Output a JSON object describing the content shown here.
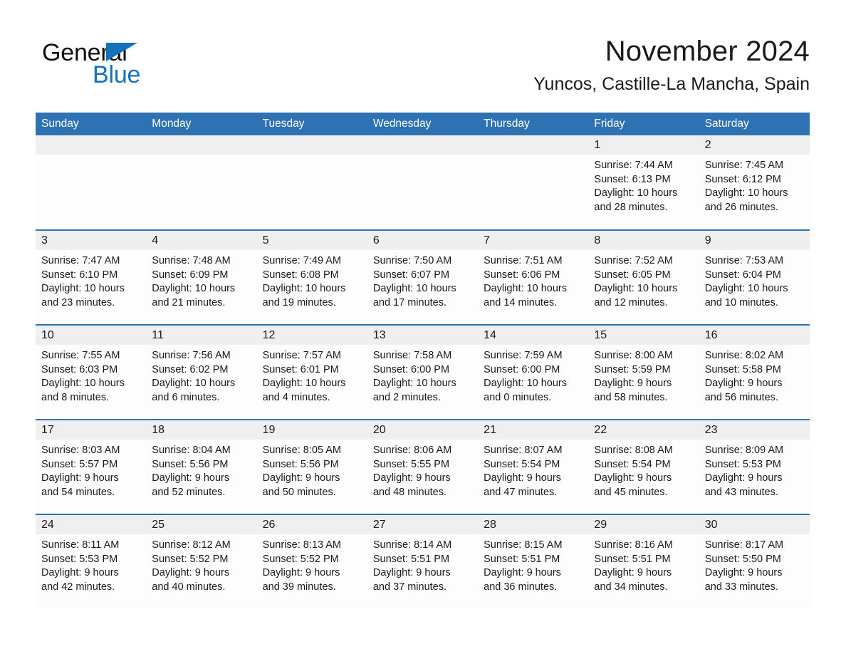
{
  "brand": {
    "logo_text_primary": "General",
    "logo_text_secondary": "Blue",
    "primary_color": "#2e72b4",
    "logo_blue": "#1571ba",
    "header_band_color": "#2e72b4",
    "daynum_band_color": "#efefef"
  },
  "header": {
    "title": "November 2024",
    "subtitle": "Yuncos, Castille-La Mancha, Spain"
  },
  "calendar": {
    "weekday_headers": [
      "Sunday",
      "Monday",
      "Tuesday",
      "Wednesday",
      "Thursday",
      "Friday",
      "Saturday"
    ],
    "weeks": [
      [
        {
          "day": "",
          "empty": true,
          "sunrise": "",
          "sunset": "",
          "daylight1": "",
          "daylight2": ""
        },
        {
          "day": "",
          "empty": true,
          "sunrise": "",
          "sunset": "",
          "daylight1": "",
          "daylight2": ""
        },
        {
          "day": "",
          "empty": true,
          "sunrise": "",
          "sunset": "",
          "daylight1": "",
          "daylight2": ""
        },
        {
          "day": "",
          "empty": true,
          "sunrise": "",
          "sunset": "",
          "daylight1": "",
          "daylight2": ""
        },
        {
          "day": "",
          "empty": true,
          "sunrise": "",
          "sunset": "",
          "daylight1": "",
          "daylight2": ""
        },
        {
          "day": "1",
          "empty": false,
          "sunrise": "Sunrise: 7:44 AM",
          "sunset": "Sunset: 6:13 PM",
          "daylight1": "Daylight: 10 hours",
          "daylight2": "and 28 minutes."
        },
        {
          "day": "2",
          "empty": false,
          "sunrise": "Sunrise: 7:45 AM",
          "sunset": "Sunset: 6:12 PM",
          "daylight1": "Daylight: 10 hours",
          "daylight2": "and 26 minutes."
        }
      ],
      [
        {
          "day": "3",
          "empty": false,
          "sunrise": "Sunrise: 7:47 AM",
          "sunset": "Sunset: 6:10 PM",
          "daylight1": "Daylight: 10 hours",
          "daylight2": "and 23 minutes."
        },
        {
          "day": "4",
          "empty": false,
          "sunrise": "Sunrise: 7:48 AM",
          "sunset": "Sunset: 6:09 PM",
          "daylight1": "Daylight: 10 hours",
          "daylight2": "and 21 minutes."
        },
        {
          "day": "5",
          "empty": false,
          "sunrise": "Sunrise: 7:49 AM",
          "sunset": "Sunset: 6:08 PM",
          "daylight1": "Daylight: 10 hours",
          "daylight2": "and 19 minutes."
        },
        {
          "day": "6",
          "empty": false,
          "sunrise": "Sunrise: 7:50 AM",
          "sunset": "Sunset: 6:07 PM",
          "daylight1": "Daylight: 10 hours",
          "daylight2": "and 17 minutes."
        },
        {
          "day": "7",
          "empty": false,
          "sunrise": "Sunrise: 7:51 AM",
          "sunset": "Sunset: 6:06 PM",
          "daylight1": "Daylight: 10 hours",
          "daylight2": "and 14 minutes."
        },
        {
          "day": "8",
          "empty": false,
          "sunrise": "Sunrise: 7:52 AM",
          "sunset": "Sunset: 6:05 PM",
          "daylight1": "Daylight: 10 hours",
          "daylight2": "and 12 minutes."
        },
        {
          "day": "9",
          "empty": false,
          "sunrise": "Sunrise: 7:53 AM",
          "sunset": "Sunset: 6:04 PM",
          "daylight1": "Daylight: 10 hours",
          "daylight2": "and 10 minutes."
        }
      ],
      [
        {
          "day": "10",
          "empty": false,
          "sunrise": "Sunrise: 7:55 AM",
          "sunset": "Sunset: 6:03 PM",
          "daylight1": "Daylight: 10 hours",
          "daylight2": "and 8 minutes."
        },
        {
          "day": "11",
          "empty": false,
          "sunrise": "Sunrise: 7:56 AM",
          "sunset": "Sunset: 6:02 PM",
          "daylight1": "Daylight: 10 hours",
          "daylight2": "and 6 minutes."
        },
        {
          "day": "12",
          "empty": false,
          "sunrise": "Sunrise: 7:57 AM",
          "sunset": "Sunset: 6:01 PM",
          "daylight1": "Daylight: 10 hours",
          "daylight2": "and 4 minutes."
        },
        {
          "day": "13",
          "empty": false,
          "sunrise": "Sunrise: 7:58 AM",
          "sunset": "Sunset: 6:00 PM",
          "daylight1": "Daylight: 10 hours",
          "daylight2": "and 2 minutes."
        },
        {
          "day": "14",
          "empty": false,
          "sunrise": "Sunrise: 7:59 AM",
          "sunset": "Sunset: 6:00 PM",
          "daylight1": "Daylight: 10 hours",
          "daylight2": "and 0 minutes."
        },
        {
          "day": "15",
          "empty": false,
          "sunrise": "Sunrise: 8:00 AM",
          "sunset": "Sunset: 5:59 PM",
          "daylight1": "Daylight: 9 hours",
          "daylight2": "and 58 minutes."
        },
        {
          "day": "16",
          "empty": false,
          "sunrise": "Sunrise: 8:02 AM",
          "sunset": "Sunset: 5:58 PM",
          "daylight1": "Daylight: 9 hours",
          "daylight2": "and 56 minutes."
        }
      ],
      [
        {
          "day": "17",
          "empty": false,
          "sunrise": "Sunrise: 8:03 AM",
          "sunset": "Sunset: 5:57 PM",
          "daylight1": "Daylight: 9 hours",
          "daylight2": "and 54 minutes."
        },
        {
          "day": "18",
          "empty": false,
          "sunrise": "Sunrise: 8:04 AM",
          "sunset": "Sunset: 5:56 PM",
          "daylight1": "Daylight: 9 hours",
          "daylight2": "and 52 minutes."
        },
        {
          "day": "19",
          "empty": false,
          "sunrise": "Sunrise: 8:05 AM",
          "sunset": "Sunset: 5:56 PM",
          "daylight1": "Daylight: 9 hours",
          "daylight2": "and 50 minutes."
        },
        {
          "day": "20",
          "empty": false,
          "sunrise": "Sunrise: 8:06 AM",
          "sunset": "Sunset: 5:55 PM",
          "daylight1": "Daylight: 9 hours",
          "daylight2": "and 48 minutes."
        },
        {
          "day": "21",
          "empty": false,
          "sunrise": "Sunrise: 8:07 AM",
          "sunset": "Sunset: 5:54 PM",
          "daylight1": "Daylight: 9 hours",
          "daylight2": "and 47 minutes."
        },
        {
          "day": "22",
          "empty": false,
          "sunrise": "Sunrise: 8:08 AM",
          "sunset": "Sunset: 5:54 PM",
          "daylight1": "Daylight: 9 hours",
          "daylight2": "and 45 minutes."
        },
        {
          "day": "23",
          "empty": false,
          "sunrise": "Sunrise: 8:09 AM",
          "sunset": "Sunset: 5:53 PM",
          "daylight1": "Daylight: 9 hours",
          "daylight2": "and 43 minutes."
        }
      ],
      [
        {
          "day": "24",
          "empty": false,
          "sunrise": "Sunrise: 8:11 AM",
          "sunset": "Sunset: 5:53 PM",
          "daylight1": "Daylight: 9 hours",
          "daylight2": "and 42 minutes."
        },
        {
          "day": "25",
          "empty": false,
          "sunrise": "Sunrise: 8:12 AM",
          "sunset": "Sunset: 5:52 PM",
          "daylight1": "Daylight: 9 hours",
          "daylight2": "and 40 minutes."
        },
        {
          "day": "26",
          "empty": false,
          "sunrise": "Sunrise: 8:13 AM",
          "sunset": "Sunset: 5:52 PM",
          "daylight1": "Daylight: 9 hours",
          "daylight2": "and 39 minutes."
        },
        {
          "day": "27",
          "empty": false,
          "sunrise": "Sunrise: 8:14 AM",
          "sunset": "Sunset: 5:51 PM",
          "daylight1": "Daylight: 9 hours",
          "daylight2": "and 37 minutes."
        },
        {
          "day": "28",
          "empty": false,
          "sunrise": "Sunrise: 8:15 AM",
          "sunset": "Sunset: 5:51 PM",
          "daylight1": "Daylight: 9 hours",
          "daylight2": "and 36 minutes."
        },
        {
          "day": "29",
          "empty": false,
          "sunrise": "Sunrise: 8:16 AM",
          "sunset": "Sunset: 5:51 PM",
          "daylight1": "Daylight: 9 hours",
          "daylight2": "and 34 minutes."
        },
        {
          "day": "30",
          "empty": false,
          "sunrise": "Sunrise: 8:17 AM",
          "sunset": "Sunset: 5:50 PM",
          "daylight1": "Daylight: 9 hours",
          "daylight2": "and 33 minutes."
        }
      ]
    ]
  }
}
